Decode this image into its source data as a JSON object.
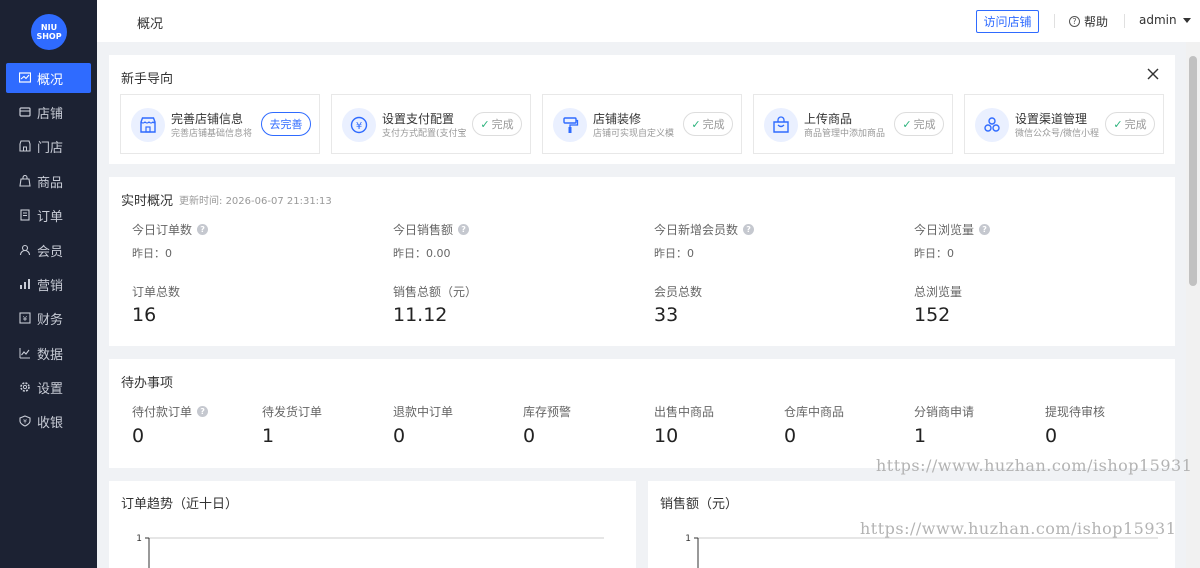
{
  "sidebar": {
    "logo_top": "NIU",
    "logo_bottom": "SHOP",
    "items": [
      {
        "label": "概况",
        "icon": "overview-icon",
        "active": true
      },
      {
        "label": "店铺",
        "icon": "store-icon"
      },
      {
        "label": "门店",
        "icon": "shop-icon"
      },
      {
        "label": "商品",
        "icon": "goods-icon"
      },
      {
        "label": "订单",
        "icon": "order-icon"
      },
      {
        "label": "会员",
        "icon": "member-icon"
      },
      {
        "label": "营销",
        "icon": "marketing-icon"
      },
      {
        "label": "财务",
        "icon": "finance-icon"
      },
      {
        "label": "数据",
        "icon": "data-icon"
      },
      {
        "label": "设置",
        "icon": "settings-icon"
      },
      {
        "label": "收银",
        "icon": "cashier-icon"
      }
    ]
  },
  "header": {
    "page_title": "概况",
    "visit_store": "访问店铺",
    "help": "帮助",
    "user": "admin"
  },
  "guide": {
    "title": "新手导向",
    "items": [
      {
        "title": "完善店铺信息",
        "desc": "完善店铺基础信息将",
        "button": "去完善",
        "status": "pending",
        "icon": "store-front-icon"
      },
      {
        "title": "设置支付配置",
        "desc": "支付方式配置(支付宝",
        "button": "完成",
        "status": "done",
        "icon": "yuan-icon"
      },
      {
        "title": "店铺装修",
        "desc": "店铺可实现自定义模",
        "button": "完成",
        "status": "done",
        "icon": "paint-roller-icon"
      },
      {
        "title": "上传商品",
        "desc": "商品管理中添加商品",
        "button": "完成",
        "status": "done",
        "icon": "shopping-bag-icon"
      },
      {
        "title": "设置渠道管理",
        "desc": "微信公众号/微信小程",
        "button": "完成",
        "status": "done",
        "icon": "channels-icon"
      }
    ]
  },
  "realtime": {
    "title": "实时概况",
    "updated_label": "更新时间:",
    "updated_time": "2026-06-07 21:31:13",
    "today": [
      {
        "label": "今日订单数",
        "yesterday": "昨日：0"
      },
      {
        "label": "今日销售额",
        "yesterday": "昨日：0.00"
      },
      {
        "label": "今日新增会员数",
        "yesterday": "昨日：0"
      },
      {
        "label": "今日浏览量",
        "yesterday": "昨日：0"
      }
    ],
    "totals": [
      {
        "label": "订单总数",
        "value": "16"
      },
      {
        "label": "销售总额（元）",
        "value": "11.12"
      },
      {
        "label": "会员总数",
        "value": "33"
      },
      {
        "label": "总浏览量",
        "value": "152"
      }
    ]
  },
  "todo": {
    "title": "待办事项",
    "items": [
      {
        "label": "待付款订单",
        "value": "0",
        "help": true
      },
      {
        "label": "待发货订单",
        "value": "1"
      },
      {
        "label": "退款中订单",
        "value": "0"
      },
      {
        "label": "库存预警",
        "value": "0"
      },
      {
        "label": "出售中商品",
        "value": "10"
      },
      {
        "label": "仓库中商品",
        "value": "0"
      },
      {
        "label": "分销商申请",
        "value": "1"
      },
      {
        "label": "提现待审核",
        "value": "0"
      }
    ]
  },
  "charts": {
    "order_trend_title": "订单趋势（近十日）",
    "sales_title": "销售额（元）"
  },
  "chart_data": [
    {
      "type": "line",
      "title": "订单趋势（近十日）",
      "y_tick_labels": [
        "1"
      ],
      "ylim": [
        0,
        1
      ]
    },
    {
      "type": "line",
      "title": "销售额（元）",
      "y_tick_labels": [
        "1"
      ],
      "ylim": [
        0,
        1
      ]
    }
  ],
  "watermark": {
    "text1": "https://www.huzhan.com/ishop15931",
    "text2": "https://www.huzhan.com/ishop15931"
  },
  "colors": {
    "primary": "#2f6bff",
    "sidebar": "#1c2233",
    "success": "#2ab27b"
  }
}
